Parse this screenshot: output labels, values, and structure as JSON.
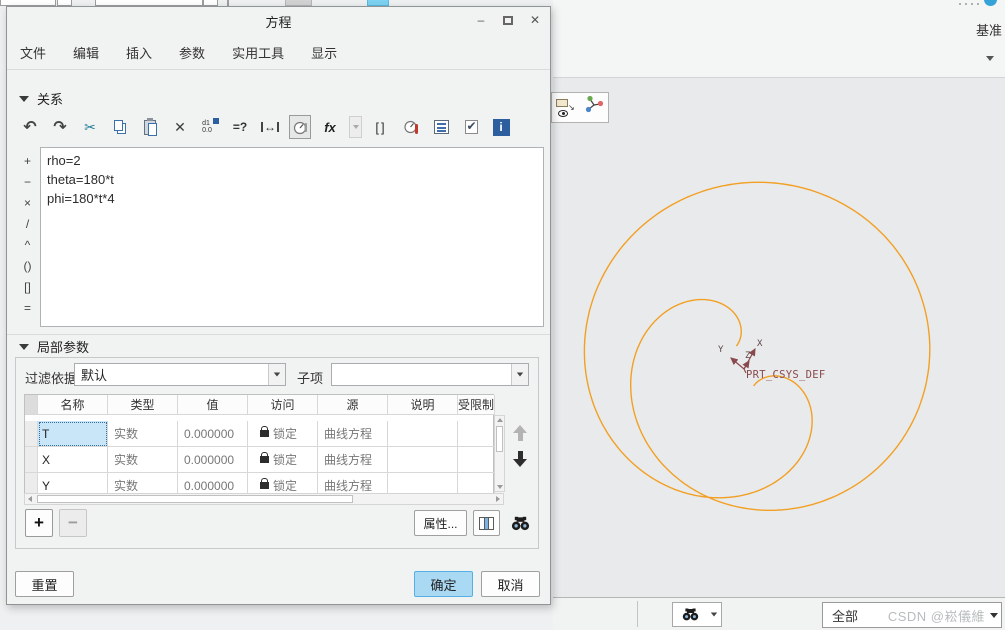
{
  "dialog": {
    "title": "方程",
    "window": {
      "minimize": "–",
      "close": "✕"
    },
    "menus": [
      "文件",
      "编辑",
      "插入",
      "参数",
      "实用工具",
      "显示"
    ],
    "relations": {
      "label": "关系",
      "toolbar": [
        {
          "name": "undo",
          "glyph": "↶"
        },
        {
          "name": "redo",
          "glyph": "↷"
        },
        {
          "name": "cut",
          "glyph": "✂"
        },
        {
          "name": "copy"
        },
        {
          "name": "paste"
        },
        {
          "name": "delete",
          "glyph": "✕"
        },
        {
          "name": "sort-dimensions",
          "glyph_top": "d1",
          "glyph_bottom": "0.0"
        },
        {
          "name": "evaluate",
          "glyph": "=?"
        },
        {
          "name": "measure",
          "glyph": "↔"
        },
        {
          "name": "insert-units",
          "pressed": true
        },
        {
          "name": "functions",
          "glyph": "fx"
        },
        {
          "name": "brackets",
          "glyph": "[]"
        },
        {
          "name": "units-review"
        },
        {
          "name": "sorted-list"
        },
        {
          "name": "verify-relations"
        },
        {
          "name": "info",
          "glyph": "i"
        }
      ]
    },
    "editor": {
      "lines": [
        "rho=2",
        "theta=180*t",
        "phi=180*t*4"
      ],
      "operators": [
        "+",
        "−",
        "×",
        "/",
        "^",
        "()",
        "[]",
        "="
      ]
    },
    "local_params": {
      "label": "局部参数",
      "filter_label": "过滤依据",
      "filter_value": "默认",
      "subitem_label": "子项",
      "subitem_value": "",
      "table": {
        "headers": [
          "名称",
          "类型",
          "值",
          "访问",
          "源",
          "说明",
          "受限制"
        ],
        "rows": [
          {
            "name": "T",
            "type": "实数",
            "value": "0.000000",
            "access": "锁定",
            "source": "曲线方程",
            "description": "",
            "restricted": ""
          },
          {
            "name": "X",
            "type": "实数",
            "value": "0.000000",
            "access": "锁定",
            "source": "曲线方程",
            "description": "",
            "restricted": ""
          },
          {
            "name": "Y",
            "type": "实数",
            "value": "0.000000",
            "access": "锁定",
            "source": "曲线方程",
            "description": "",
            "restricted": ""
          }
        ]
      },
      "buttons": {
        "add": "+",
        "remove": "−",
        "properties": "属性..."
      }
    },
    "footer": {
      "reset": "重置",
      "ok": "确定",
      "cancel": "取消"
    }
  },
  "workspace": {
    "ribbon": {
      "datum_label": "基准"
    },
    "status": {
      "filter_value": "全部",
      "watermark": "CSDN @崧儀維"
    }
  },
  "scene": {
    "csys": {
      "label": "PRT_CSYS_DEF",
      "axis_x": "X",
      "axis_y": "Y",
      "axis_z": "Z",
      "color": "#8a4a4d"
    },
    "curve": {
      "type": "parametric-3d",
      "equations": {
        "rho": "2",
        "theta": "180*t",
        "phi": "180*t*4"
      },
      "rho": 2,
      "theta_deg": 180,
      "phi_deg": 720,
      "samples": 800,
      "center": [
        745,
        366
      ],
      "scale": 95,
      "proj_row1": [
        0.6,
        -0.81,
        -0.045
      ],
      "proj_row2": [
        -0.8,
        -0.59,
        -0.105
      ],
      "color": "#f2a024"
    }
  }
}
